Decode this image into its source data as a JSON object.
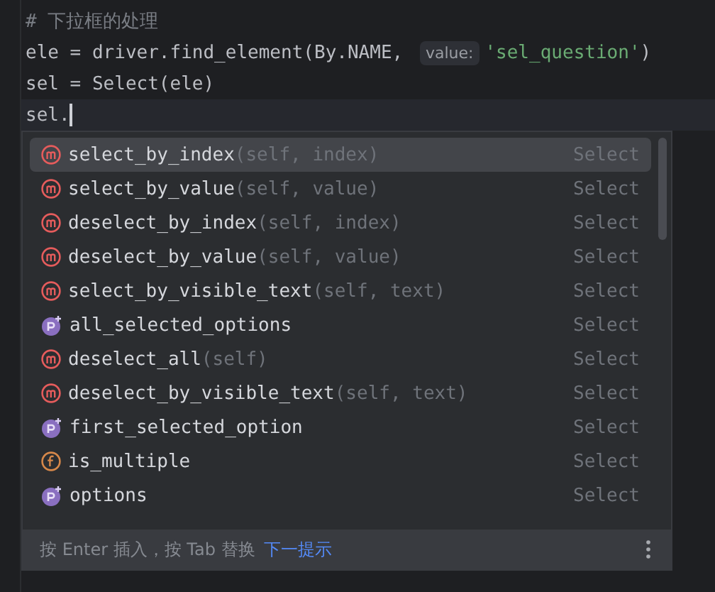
{
  "editor": {
    "lines": [
      {
        "kind": "comment",
        "text": "# 下拉框的处理"
      },
      {
        "kind": "call",
        "before": "ele = driver.find_element(By.NAME, ",
        "hint": "value:",
        "string": "'sel_question'",
        "after": ")"
      },
      {
        "kind": "code",
        "text": "sel = Select(ele)"
      },
      {
        "kind": "current",
        "text": "sel."
      }
    ]
  },
  "completion": {
    "items": [
      {
        "kind": "method",
        "name": "select_by_index",
        "params": "(self, index)",
        "type": "Select",
        "selected": true
      },
      {
        "kind": "method",
        "name": "select_by_value",
        "params": "(self, value)",
        "type": "Select",
        "selected": false
      },
      {
        "kind": "method",
        "name": "deselect_by_index",
        "params": "(self, index)",
        "type": "Select",
        "selected": false
      },
      {
        "kind": "method",
        "name": "deselect_by_value",
        "params": "(self, value)",
        "type": "Select",
        "selected": false
      },
      {
        "kind": "method",
        "name": "select_by_visible_text",
        "params": "(self, text)",
        "type": "Select",
        "selected": false
      },
      {
        "kind": "property",
        "name": "all_selected_options",
        "type": "Select",
        "selected": false
      },
      {
        "kind": "method",
        "name": "deselect_all",
        "params": "(self)",
        "type": "Select",
        "selected": false
      },
      {
        "kind": "method",
        "name": "deselect_by_visible_text",
        "params": "(self, text)",
        "type": "Select",
        "selected": false
      },
      {
        "kind": "property",
        "name": "first_selected_option",
        "type": "Select",
        "selected": false
      },
      {
        "kind": "function",
        "name": "is_multiple",
        "type": "Select",
        "selected": false
      },
      {
        "kind": "property",
        "name": "options",
        "type": "Select",
        "selected": false
      }
    ],
    "footer": {
      "hint": "按 Enter 插入，按 Tab 替换",
      "link": "下一提示"
    }
  }
}
